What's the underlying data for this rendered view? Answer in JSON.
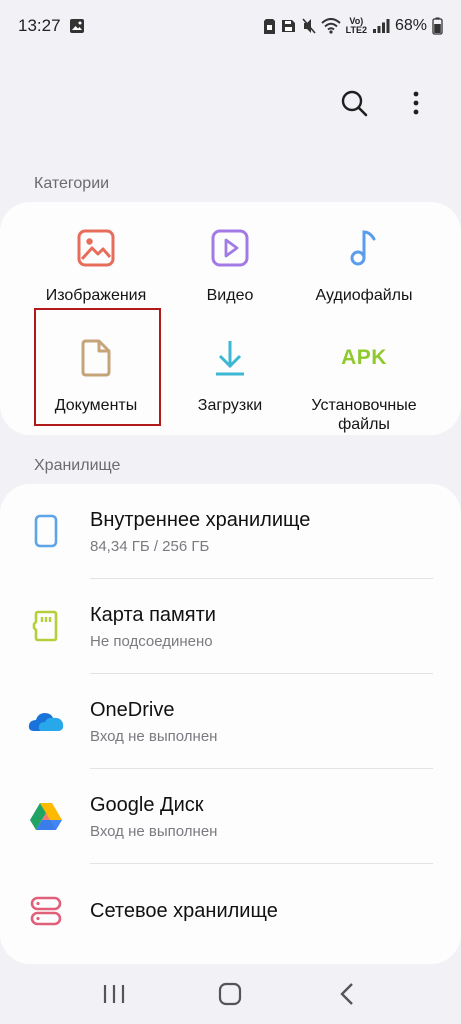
{
  "status": {
    "time": "13:27",
    "volte": "Vo)",
    "lte": "LTE2",
    "battery": "68%"
  },
  "toolbar": {
    "search_icon": "search-icon",
    "more_icon": "more-vertical-icon"
  },
  "categories": {
    "title": "Категории",
    "items": [
      {
        "label": "Изображения",
        "icon": "image-icon",
        "color": "#e76d5a"
      },
      {
        "label": "Видео",
        "icon": "video-icon",
        "color": "#a27ae6"
      },
      {
        "label": "Аудиофайлы",
        "icon": "music-note-icon",
        "color": "#5b9ded"
      },
      {
        "label": "Документы",
        "icon": "document-icon",
        "color": "#c6a47a"
      },
      {
        "label": "Загрузки",
        "icon": "download-icon",
        "color": "#3cb8d4"
      },
      {
        "label": "Установочные файлы",
        "icon": "apk-icon",
        "icon_text": "APK",
        "color": "#8fc92e"
      }
    ]
  },
  "storage": {
    "title": "Хранилище",
    "items": [
      {
        "title": "Внутреннее хранилище",
        "subtitle": "84,34 ГБ / 256 ГБ",
        "icon": "phone-icon",
        "color": "#5ea4e8"
      },
      {
        "title": "Карта памяти",
        "subtitle": "Не подсоединено",
        "icon": "sd-card-icon",
        "color": "#b5cf3b"
      },
      {
        "title": "OneDrive",
        "subtitle": "Вход не выполнен",
        "icon": "onedrive-icon",
        "color": "#1a73d9"
      },
      {
        "title": "Google Диск",
        "subtitle": "Вход не выполнен",
        "icon": "google-drive-icon",
        "color": "#1fa463"
      },
      {
        "title": "Сетевое хранилище",
        "icon": "network-storage-icon",
        "color": "#e0607a"
      }
    ]
  },
  "navbar": {
    "recents_icon": "recents-icon",
    "home_icon": "home-icon",
    "back_icon": "back-icon"
  }
}
